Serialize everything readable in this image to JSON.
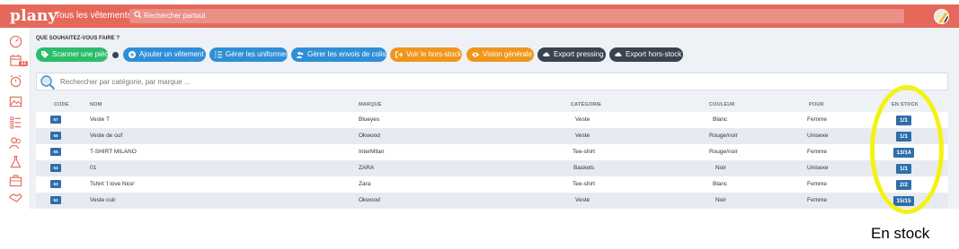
{
  "header": {
    "logo": "plany",
    "title": "Tous les vêtements",
    "search_placeholder": "Rechercher partout",
    "accent": "#e5685b"
  },
  "sidebar": {
    "items": [
      {
        "icon": "speedometer-icon"
      },
      {
        "icon": "calendar-icon",
        "badge": "11"
      },
      {
        "icon": "alarm-clock-icon"
      },
      {
        "icon": "image-icon"
      },
      {
        "icon": "list-icon"
      },
      {
        "icon": "users-icon"
      },
      {
        "icon": "flask-icon"
      },
      {
        "icon": "briefcase-icon"
      },
      {
        "icon": "handshake-icon"
      }
    ]
  },
  "main": {
    "question": "QUE SOUHAITEZ-VOUS FAIRE ?",
    "actions": [
      {
        "label": "Scanner une pièce",
        "icon": "tag-icon",
        "color": "#2bbd6b"
      },
      {
        "label": "Ajouter un vêtement",
        "icon": "plus-circle-icon",
        "color": "#2f8fd6"
      },
      {
        "label": "Gérer les uniformes",
        "icon": "list-icon",
        "color": "#2f8fd6"
      },
      {
        "label": "Gérer les envois de colis",
        "icon": "users-icon",
        "color": "#2f8fd6"
      },
      {
        "label": "Voir le hors-stock",
        "icon": "sign-out-icon",
        "color": "#f0961d"
      },
      {
        "label": "Vision générale",
        "icon": "eye-icon",
        "color": "#f0961d"
      },
      {
        "label": "Export pressing",
        "icon": "cloud-download-icon",
        "color": "#3b4350"
      },
      {
        "label": "Export hors-stock",
        "icon": "cloud-download-icon",
        "color": "#3b4350"
      }
    ],
    "filter_placeholder": "Rechercher par catégorie, par marque ..."
  },
  "table": {
    "headers": {
      "code": "CODE",
      "nom": "NOM",
      "marque": "MARQUE",
      "categorie": "CATÉGORIE",
      "couleur": "COULEUR",
      "pour": "POUR",
      "stock": "EN STOCK"
    },
    "rows": [
      {
        "code": "57",
        "nom": "Veste T",
        "marque": "Blueyes",
        "categorie": "Veste",
        "couleur": "Blanc",
        "pour": "Femme",
        "stock": "1/1"
      },
      {
        "code": "56",
        "nom": "Veste de ouf",
        "marque": "Okwood",
        "categorie": "Veste",
        "couleur": "Rouge/noir",
        "pour": "Unisexe",
        "stock": "1/1"
      },
      {
        "code": "55",
        "nom": "T-SHIRT MILANO",
        "marque": "InterMilan",
        "categorie": "Tee-shirt",
        "couleur": "Rouge/noir",
        "pour": "Femme",
        "stock": "13/14"
      },
      {
        "code": "54",
        "nom": "01",
        "marque": "ZARA",
        "categorie": "Baskets",
        "couleur": "Noir",
        "pour": "Unisexe",
        "stock": "1/1"
      },
      {
        "code": "53",
        "nom": "Tshirt 'I love Nice'",
        "marque": "Zara",
        "categorie": "Tee-shirt",
        "couleur": "Blanc",
        "pour": "Femme",
        "stock": "2/2"
      },
      {
        "code": "52",
        "nom": "Veste cuir",
        "marque": "Okwood",
        "categorie": "Veste",
        "couleur": "Noir",
        "pour": "Femme",
        "stock": "15/15"
      }
    ]
  },
  "annotation": {
    "caption": "En stock",
    "color": "#f4f212"
  }
}
